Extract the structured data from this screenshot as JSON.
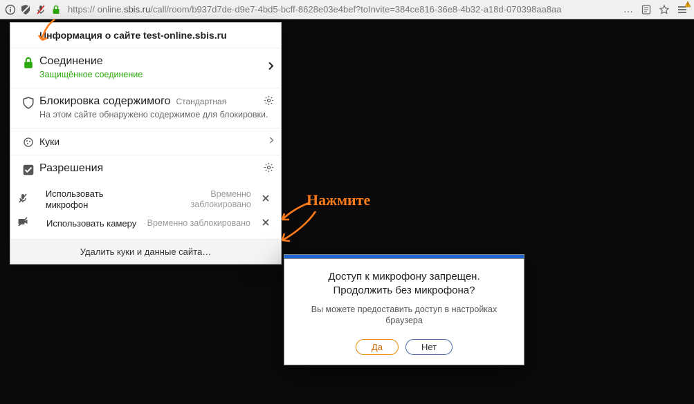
{
  "chrome": {
    "url_prefix": "https:// online.",
    "url_host": "sbis.ru",
    "url_path": "/call/room/b937d7de-d9e7-4bd5-bcff-8628e03e4bef?toInvite=384ce816-36e8-4b32-a18d-070398aa8aa",
    "ellipsis": "…"
  },
  "panel": {
    "header": "Информация о сайте test-online.sbis.ru",
    "conn": {
      "title": "Соединение",
      "status": "Защищённое соединение"
    },
    "block": {
      "title": "Блокировка содержимого",
      "chip": "Стандартная",
      "desc": "На этом сайте обнаружено содержимое для блокировки."
    },
    "cookies": "Куки",
    "perms": {
      "title": "Разрешения",
      "mic": {
        "name": "Использовать микрофон",
        "state": "Временно заблокировано"
      },
      "cam": {
        "name": "Использовать камеру",
        "state": "Временно заблокировано"
      }
    },
    "footer": "Удалить куки и данные сайта…"
  },
  "dialog": {
    "title": "Доступ к микрофону запрещен. Продолжить без микрофона?",
    "msg": "Вы можете предоставить доступ в настройках браузера",
    "yes": "Да",
    "no": "Нет"
  },
  "ann": {
    "text": "Нажмите"
  },
  "colors": {
    "accent": "#ff7a18",
    "green": "#2ba80b",
    "blue": "#2067d4"
  }
}
